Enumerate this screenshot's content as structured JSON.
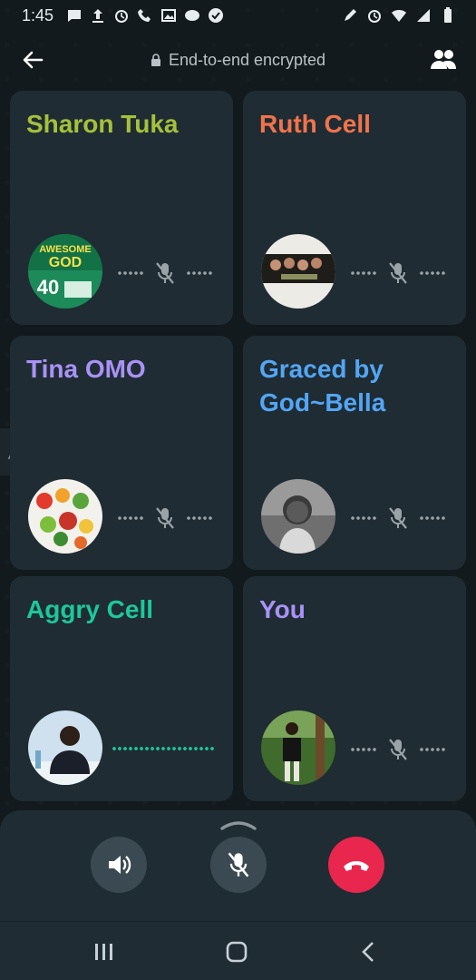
{
  "status_bar": {
    "time": "1:45",
    "icons_left": [
      "message-icon",
      "upload-icon",
      "alarm-icon",
      "phone-icon",
      "image-icon",
      "chat-bubble-icon",
      "check-circle-icon"
    ],
    "icons_right": [
      "pencil-icon",
      "alarm-icon",
      "wifi-icon",
      "signal-icon",
      "battery-icon"
    ]
  },
  "header": {
    "encryption_text": "End-to-end encrypted",
    "back_icon": "arrow-left-icon",
    "participants_icon": "group-icon"
  },
  "participants": [
    {
      "name": "Sharon Tuka",
      "color": "#a5c13b",
      "state": "muted"
    },
    {
      "name": "Ruth Cell",
      "color": "#f2734b",
      "state": "muted"
    },
    {
      "name": "Tina OMO",
      "color": "#a992f7",
      "state": "muted"
    },
    {
      "name": "Graced by God~Bella",
      "color": "#53a6f5",
      "state": "muted"
    },
    {
      "name": "Aggry Cell",
      "color": "#1ec79b",
      "state": "speaking"
    },
    {
      "name": "You",
      "color": "#a992f7",
      "state": "muted"
    }
  ],
  "controls": {
    "speaker_icon": "speaker-icon",
    "mute_icon": "mic-off-icon",
    "end_icon": "end-call-icon",
    "end_color": "#e9264d"
  },
  "navigation": {
    "recents_icon": "recents-icon",
    "home_icon": "home-icon",
    "back_icon": "back-chevron-icon"
  }
}
